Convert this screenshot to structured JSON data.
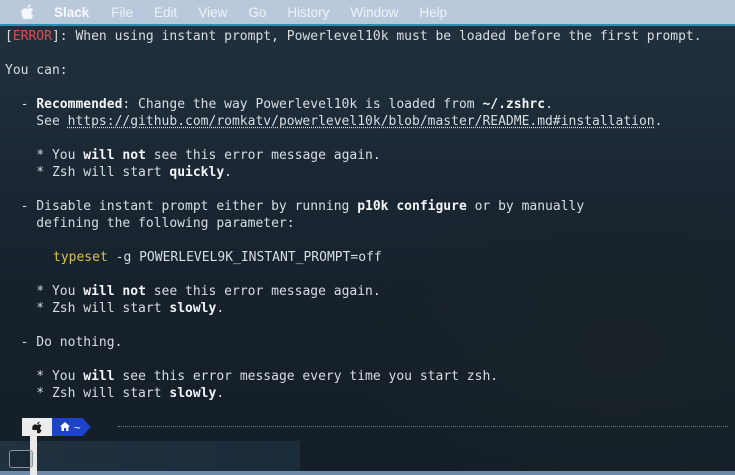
{
  "menubar": {
    "app_name": "Slack",
    "items": [
      "File",
      "Edit",
      "View",
      "Go",
      "History",
      "Window",
      "Help"
    ]
  },
  "terminal": {
    "error_tag": "ERROR",
    "error_msg": ": When using instant prompt, Powerlevel10k must be loaded before the first prompt.",
    "you_can": "You can:",
    "rec_dash": "  - ",
    "rec_label": "Recommended",
    "rec_text": ": Change the way Powerlevel10k is loaded from ",
    "rec_file": "~/.zshrc",
    "rec_end": ".",
    "see": "    See ",
    "see_link": "https://github.com/romkatv/powerlevel10k/blob/master/README.md#installation",
    "see_end": ".",
    "r1_pre": "    * You ",
    "r1_b": "will not",
    "r1_post": " see this error message again.",
    "r2_pre": "    * Zsh will start ",
    "r2_b": "quickly",
    "r2_post": ".",
    "dis_pre": "  - Disable instant prompt either by running ",
    "dis_cmd": "p10k configure",
    "dis_post": " or by manually",
    "dis_line2": "    defining the following parameter:",
    "typeset_kw": "typeset",
    "typeset_rest": " -g POWERLEVEL9K_INSTANT_PROMPT=off",
    "d1_pre": "    * You ",
    "d1_b": "will not",
    "d1_post": " see this error message again.",
    "d2_pre": "    * Zsh will start ",
    "d2_b": "slowly",
    "d2_post": ".",
    "nothing": "  - Do nothing.",
    "n1_pre": "    * You ",
    "n1_b": "will",
    "n1_post": " see this error message every time you start zsh.",
    "n2_pre": "    * Zsh will start ",
    "n2_b": "slowly",
    "n2_post": "."
  },
  "prompt": {
    "os_icon": "apple-icon",
    "dir_icon": "home-icon",
    "dir": "~"
  }
}
